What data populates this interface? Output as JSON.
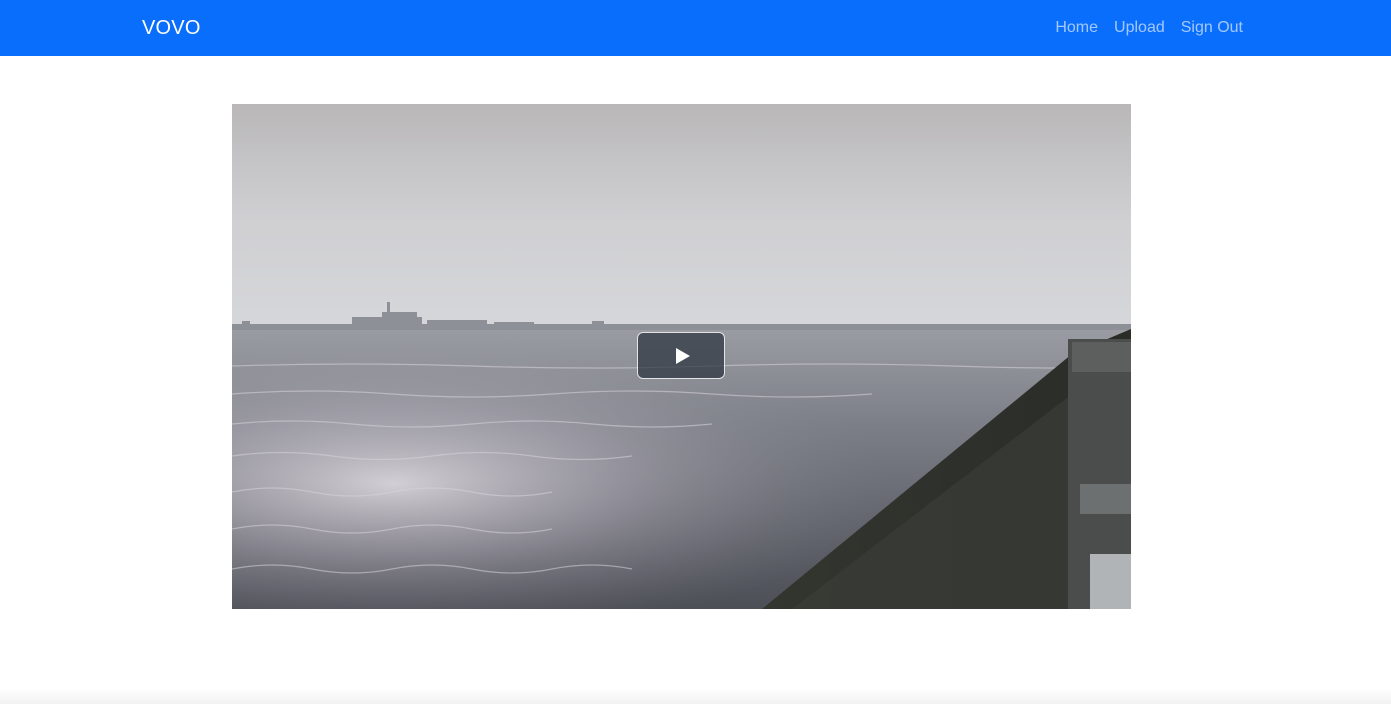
{
  "navbar": {
    "brand": "VOVO",
    "background_color": "#0a6efd",
    "links": [
      {
        "label": "Home"
      },
      {
        "label": "Upload"
      },
      {
        "label": "Sign Out"
      }
    ]
  },
  "video": {
    "play_icon": "play-icon",
    "scene": "sea with embankment under hazy sky"
  }
}
